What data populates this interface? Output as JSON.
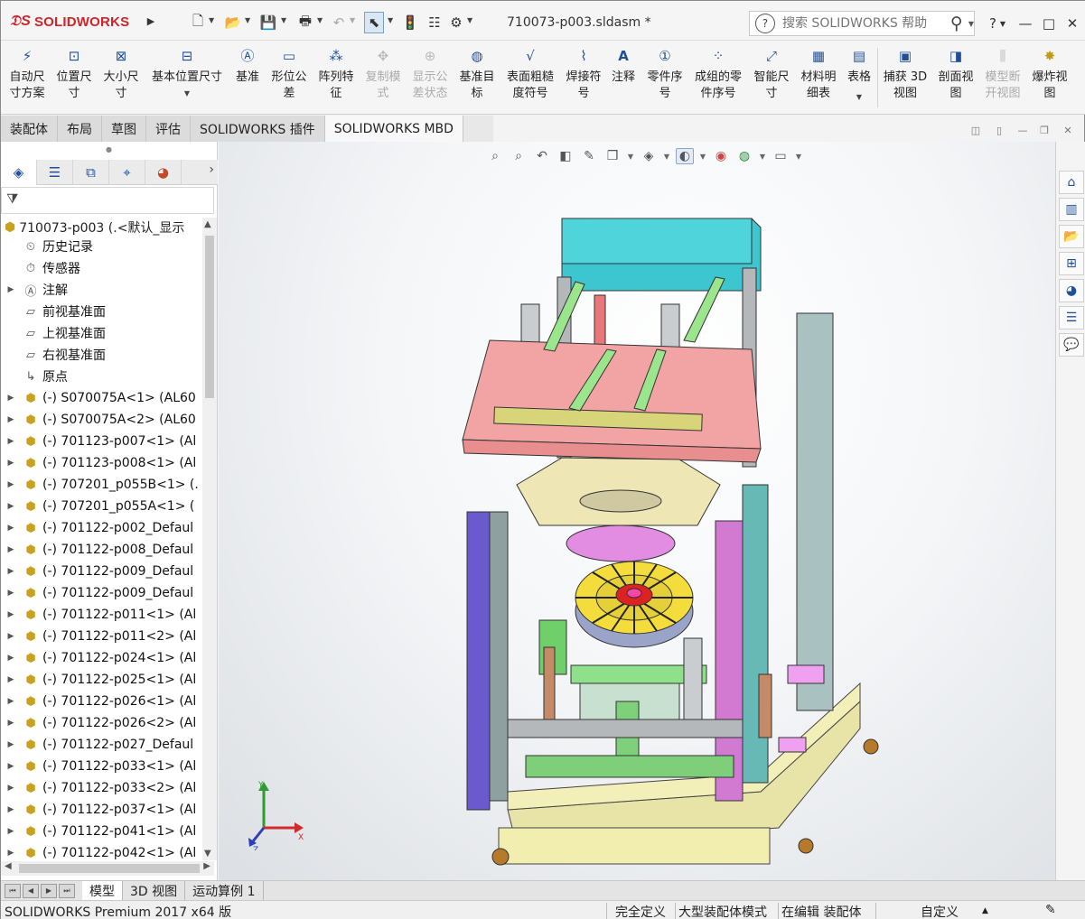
{
  "app": {
    "logo_text": "SOLIDWORKS",
    "doc_title": "710073-p003.sldasm *",
    "search_placeholder": "搜索 SOLIDWORKS 帮助"
  },
  "quick_access": {
    "icons": [
      "new-icon",
      "open-icon",
      "save-icon",
      "print-icon",
      "undo-icon",
      "select-icon",
      "rebuild-icon",
      "file-properties-icon",
      "options-icon"
    ]
  },
  "window_controls": [
    "?",
    "—",
    "□",
    "✕"
  ],
  "command_manager": {
    "items": [
      {
        "label": "自动尺\n寸方案",
        "icon": "auto-dimension-icon",
        "disabled": false
      },
      {
        "label": "位置尺\n寸",
        "icon": "location-dimension-icon",
        "disabled": false
      },
      {
        "label": "大小尺\n寸",
        "icon": "size-dimension-icon",
        "disabled": false
      },
      {
        "label": "基本位置尺寸",
        "icon": "basic-location-dimension-icon",
        "disabled": false
      },
      {
        "label": "基准",
        "icon": "datum-icon",
        "disabled": false
      },
      {
        "label": "形位公\n差",
        "icon": "geometric-tolerance-icon",
        "disabled": false
      },
      {
        "label": "阵列特\n征",
        "icon": "pattern-feature-icon",
        "disabled": false
      },
      {
        "label": "复制模\n式",
        "icon": "copy-scheme-icon",
        "disabled": true
      },
      {
        "label": "显示公\n差状态",
        "icon": "show-tolerance-status-icon",
        "disabled": true
      },
      {
        "label": "基准目\n标",
        "icon": "datum-target-icon",
        "disabled": false
      },
      {
        "label": "表面粗糙\n度符号",
        "icon": "surface-finish-icon",
        "disabled": false
      },
      {
        "label": "焊接符\n号",
        "icon": "weld-symbol-icon",
        "disabled": false
      },
      {
        "label": "注释",
        "icon": "note-icon",
        "disabled": false
      },
      {
        "label": "零件序\n号",
        "icon": "balloon-icon",
        "disabled": false
      },
      {
        "label": "成组的零\n件序号",
        "icon": "stacked-balloon-icon",
        "disabled": false
      },
      {
        "label": "智能尺\n寸",
        "icon": "smart-dimension-icon",
        "disabled": false
      },
      {
        "label": "材料明\n细表",
        "icon": "bom-icon",
        "disabled": false
      },
      {
        "label": "表格",
        "icon": "table-icon",
        "disabled": false
      },
      {
        "label": "捕获 3D\n视图",
        "icon": "capture-3d-view-icon",
        "disabled": false
      },
      {
        "label": "剖面视\n图",
        "icon": "section-view-icon",
        "disabled": false
      },
      {
        "label": "模型断\n开视图",
        "icon": "model-break-view-icon",
        "disabled": true
      },
      {
        "label": "爆炸视\n图",
        "icon": "exploded-view-icon",
        "disabled": false
      }
    ]
  },
  "tabs": [
    "装配体",
    "布局",
    "草图",
    "评估",
    "SOLIDWORKS 插件",
    "SOLIDWORKS MBD"
  ],
  "active_tab": "SOLIDWORKS MBD",
  "feature_tree": {
    "root": "710073-p003  (.<默认_显示",
    "items": [
      {
        "label": "历史记录",
        "type": "folder",
        "expandable": false
      },
      {
        "label": "传感器",
        "type": "sensor",
        "expandable": false
      },
      {
        "label": "注解",
        "type": "annotation",
        "expandable": true
      },
      {
        "label": "前视基准面",
        "type": "plane",
        "expandable": false
      },
      {
        "label": "上视基准面",
        "type": "plane",
        "expandable": false
      },
      {
        "label": "右视基准面",
        "type": "plane",
        "expandable": false
      },
      {
        "label": "原点",
        "type": "origin",
        "expandable": false
      },
      {
        "label": "(-) S070075A<1> (AL60",
        "type": "subassembly",
        "expandable": true
      },
      {
        "label": "(-) S070075A<2> (AL60",
        "type": "subassembly",
        "expandable": true
      },
      {
        "label": "(-) 701123-p007<1> (Al",
        "type": "subassembly",
        "expandable": true
      },
      {
        "label": "(-) 701123-p008<1> (Al",
        "type": "subassembly",
        "expandable": true
      },
      {
        "label": "(-) 707201_p055B<1> (.",
        "type": "subassembly",
        "expandable": true
      },
      {
        "label": "(-) 707201_p055A<1> (",
        "type": "subassembly",
        "expandable": true
      },
      {
        "label": "(-) 701122-p002_Defaul",
        "type": "subassembly",
        "expandable": true
      },
      {
        "label": "(-) 701122-p008_Defaul",
        "type": "subassembly",
        "expandable": true
      },
      {
        "label": "(-) 701122-p009_Defaul",
        "type": "subassembly",
        "expandable": true
      },
      {
        "label": "(-) 701122-p009_Defaul",
        "type": "subassembly",
        "expandable": true
      },
      {
        "label": "(-) 701122-p011<1> (Al",
        "type": "subassembly",
        "expandable": true
      },
      {
        "label": "(-) 701122-p011<2> (Al",
        "type": "subassembly",
        "expandable": true
      },
      {
        "label": "(-) 701122-p024<1> (Al",
        "type": "subassembly",
        "expandable": true
      },
      {
        "label": "(-) 701122-p025<1> (Al",
        "type": "subassembly",
        "expandable": true
      },
      {
        "label": "(-) 701122-p026<1> (Al",
        "type": "subassembly",
        "expandable": true
      },
      {
        "label": "(-) 701122-p026<2> (Al",
        "type": "subassembly",
        "expandable": true
      },
      {
        "label": "(-) 701122-p027_Defaul",
        "type": "subassembly",
        "expandable": true
      },
      {
        "label": "(-) 701122-p033<1> (Al",
        "type": "subassembly",
        "expandable": true
      },
      {
        "label": "(-) 701122-p033<2> (Al",
        "type": "subassembly",
        "expandable": true
      },
      {
        "label": "(-) 701122-p037<1> (Al",
        "type": "subassembly",
        "expandable": true
      },
      {
        "label": "(-) 701122-p041<1> (Al",
        "type": "subassembly",
        "expandable": true
      },
      {
        "label": "(-) 701122-p042<1> (Al",
        "type": "subassembly",
        "expandable": true
      }
    ]
  },
  "bottom_tabs": [
    "模型",
    "3D 视图",
    "运动算例 1"
  ],
  "active_bottom_tab": "模型",
  "triad": {
    "x": "X",
    "y": "Y",
    "z": "Z"
  },
  "status": {
    "product": "SOLIDWORKS Premium 2017 x64 版",
    "definition": "完全定义",
    "mode": "大型装配体模式",
    "editing": "在编辑 装配体",
    "units": "自定义"
  }
}
